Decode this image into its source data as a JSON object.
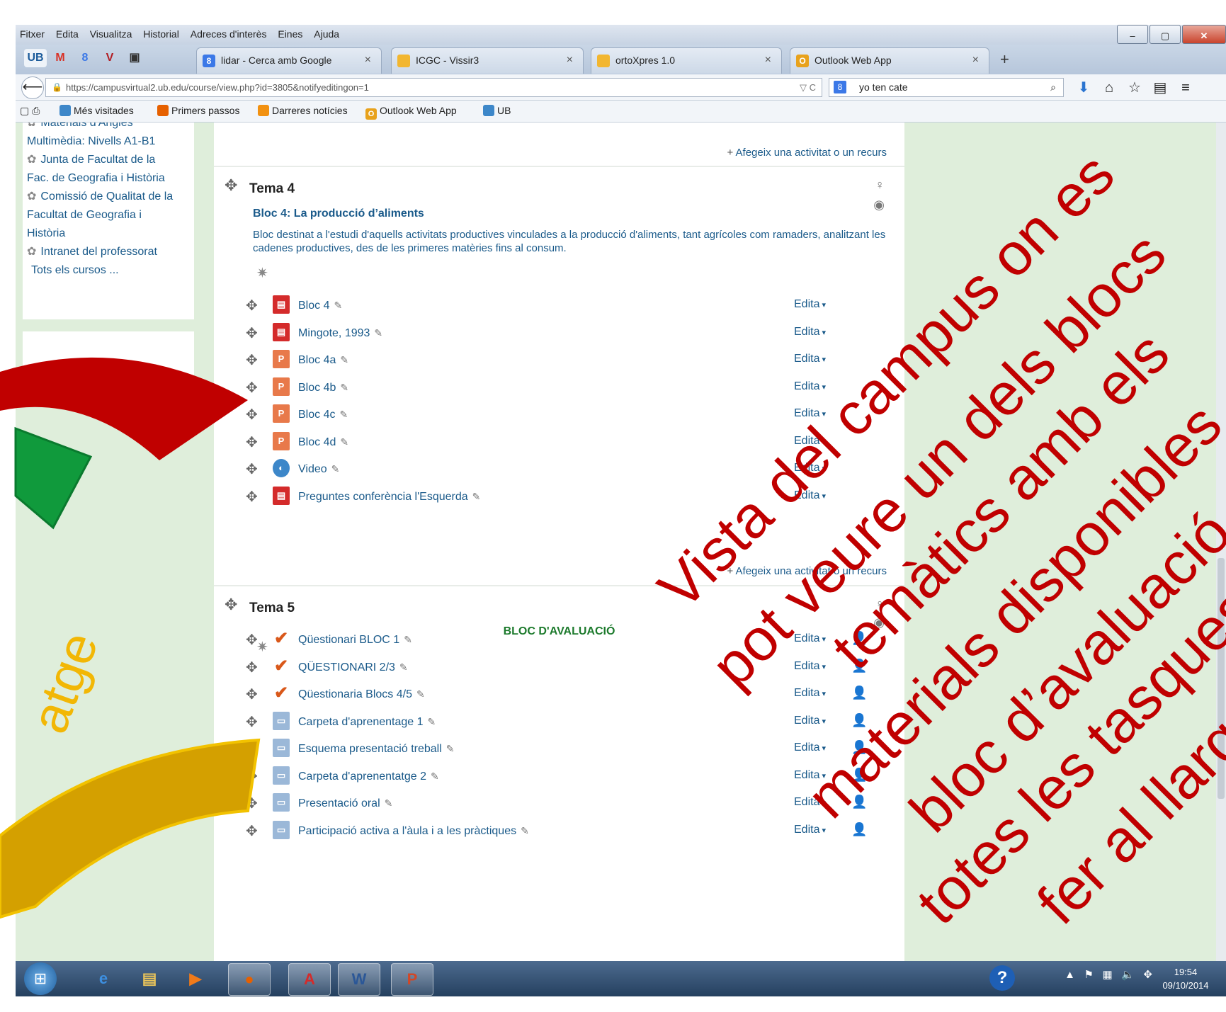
{
  "menu": [
    "Fitxer",
    "Edita",
    "Visualitza",
    "Historial",
    "Adreces d'interès",
    "Eines",
    "Ajuda"
  ],
  "window_buttons": [
    "minimize-icon",
    "maximize-icon",
    "close-icon"
  ],
  "pinned_tabs": [
    {
      "icon": "ub-icon",
      "glyph": "UB",
      "color": "#1a5a9a"
    },
    {
      "icon": "gmail-icon",
      "glyph": "M",
      "color": "#d93025"
    },
    {
      "icon": "google-icon",
      "glyph": "8",
      "color": "#3b78e7"
    },
    {
      "icon": "vivaldi-icon",
      "glyph": "V",
      "color": "#b21d23"
    },
    {
      "icon": "screen-icon",
      "glyph": "▣",
      "color": "#333333"
    }
  ],
  "tabs": [
    {
      "label": "lidar - Cerca amb Google",
      "icon": "google-icon",
      "color": "#3b78e7",
      "glyph": "8"
    },
    {
      "label": "ICGC - Vissir3",
      "icon": "folder-icon",
      "color": "#f2b630",
      "glyph": ""
    },
    {
      "label": "ortoXpres 1.0",
      "icon": "folder-icon",
      "color": "#f2b630",
      "glyph": ""
    },
    {
      "label": "Outlook Web App",
      "icon": "outlook-icon",
      "color": "#e8a21c",
      "glyph": "O"
    }
  ],
  "tab_close": "×",
  "new_tab": "+",
  "nav": {
    "url": "https://campusvirtual2.ub.edu/course/view.php?id=3805&notifyeditingon=1",
    "url_host_bold": "ub.edu",
    "url_controls": "▽ C",
    "search_value": "yo ten cate",
    "search_engine_icon": "google-icon"
  },
  "bookmarks": [
    {
      "label": "Més visitades",
      "icon": "most-visited-icon",
      "color": "#3d87c9"
    },
    {
      "label": "Primers passos",
      "icon": "firefox-icon",
      "color": "#e66000"
    },
    {
      "label": "Darreres notícies",
      "icon": "rss-icon",
      "color": "#f29111"
    },
    {
      "label": "Outlook Web App",
      "icon": "outlook-icon",
      "color": "#e8a21c"
    },
    {
      "label": "UB",
      "icon": "ub-icon",
      "color": "#3d87c9"
    }
  ],
  "sidebar": {
    "items": [
      {
        "label": "Materials d'Anglès"
      },
      {
        "label": "Multimèdia: Nivells A1-B1"
      },
      {
        "label": "Junta de Facultat de la"
      },
      {
        "label": "Fac. de Geografia i Història"
      },
      {
        "label": "Comissió de Qualitat de la"
      },
      {
        "label": "Facultat de Geografia i"
      },
      {
        "label": "Història"
      },
      {
        "label": "Intranet del professorat"
      },
      {
        "label": "Tots els cursos ..."
      }
    ]
  },
  "add_activity_label": "Afegeix una activitat o un recurs",
  "edit_label": "Edita",
  "tema4": {
    "title": "Tema 4",
    "subtitle": "Bloc 4: La producció d’aliments",
    "summary": "Bloc destinat a l'estudi d'aquells activitats productives vinculades a la producció d'aliments, tant agrícoles com ramaders, analitzant les cadenes productives, des de les primeres matèries fins al consum.",
    "activities": [
      {
        "name": "Bloc 4",
        "type": "pdf"
      },
      {
        "name": "Mingote, 1993",
        "type": "pdf"
      },
      {
        "name": "Bloc 4a",
        "type": "ppt"
      },
      {
        "name": "Bloc 4b",
        "type": "ppt"
      },
      {
        "name": "Bloc 4c",
        "type": "ppt"
      },
      {
        "name": "Bloc 4d",
        "type": "ppt"
      },
      {
        "name": "Video",
        "type": "web"
      },
      {
        "name": "Preguntes conferència l'Esquerda",
        "type": "pdf"
      }
    ]
  },
  "tema5": {
    "title": "Tema 5",
    "subtitle": "BLOC D'AVALUACIÓ",
    "activities": [
      {
        "name": "Qüestionari BLOC 1",
        "type": "quiz"
      },
      {
        "name": "QÜESTIONARI 2/3",
        "type": "quiz"
      },
      {
        "name": "Qüestionaria Blocs 4/5",
        "type": "quiz"
      },
      {
        "name": "Carpeta d'aprenentage 1",
        "type": "assign"
      },
      {
        "name": "Esquema presentació treball",
        "type": "assign"
      },
      {
        "name": "Carpeta d'aprenentatge 2",
        "type": "assign"
      },
      {
        "name": "Presentació oral",
        "type": "assign"
      },
      {
        "name": "Participació activa a l'àula i a les pràctiques",
        "type": "assign"
      }
    ]
  },
  "taskbar": {
    "apps": [
      {
        "icon": "ie-icon",
        "glyph": "e",
        "color": "#3d8fe0"
      },
      {
        "icon": "explorer-icon",
        "glyph": "▤",
        "color": "#e8c35a"
      },
      {
        "icon": "media-icon",
        "glyph": "▶",
        "color": "#f07a1a"
      },
      {
        "icon": "firefox-icon",
        "glyph": "●",
        "color": "#e66000"
      },
      {
        "icon": "acrobat-icon",
        "glyph": "A",
        "color": "#d42b2b"
      },
      {
        "icon": "word-icon",
        "glyph": "W",
        "color": "#2b5797"
      },
      {
        "icon": "powerpoint-icon",
        "glyph": "P",
        "color": "#d24726"
      }
    ],
    "time": "19:54",
    "date": "09/10/2014"
  },
  "overlay": {
    "text_color": "#c00000",
    "side_word": "atge",
    "side_word_color": "#f2b705",
    "lines": [
      "Vista del campus on es",
      "pot veure un dels blocs",
      "temàtics amb els",
      "materials disponibles",
      "bloc d’avaluació",
      "totes les tasques",
      "fer al llarg"
    ],
    "arc_colors": [
      "#c00000",
      "#109a3c",
      "#d4a000"
    ]
  }
}
